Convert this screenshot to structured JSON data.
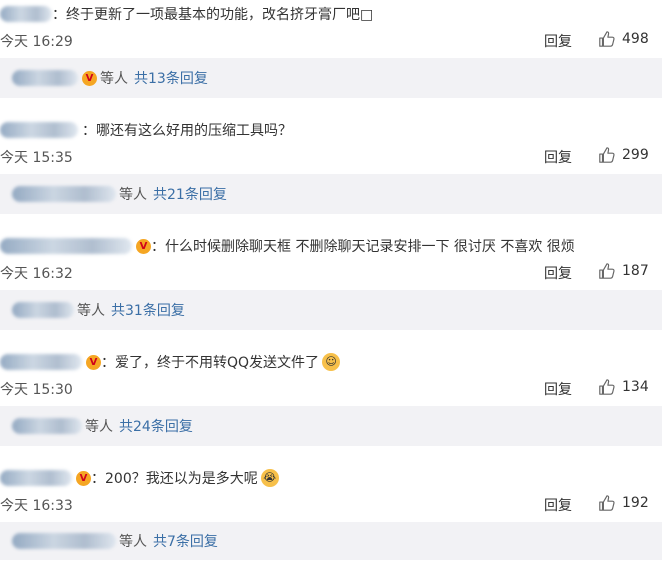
{
  "colors": {
    "link": "#3b6fa6",
    "text": "#333333",
    "sub_bg": "#f2f2f5"
  },
  "icons": {
    "like": "thumbs-up-outline-icon"
  },
  "comments": [
    {
      "text": "：终于更新了一项最基本的功能，改名挤牙膏厂吧□",
      "time": "今天 16:29",
      "reply": "回复",
      "likes": "498",
      "sub_dengren": "等人",
      "sub_total": "共13条回复"
    },
    {
      "text": "：哪还有这么好用的压缩工具吗？",
      "time": "今天 15:35",
      "reply": "回复",
      "likes": "299",
      "sub_dengren": "等人",
      "sub_total": "共21条回复"
    },
    {
      "text": "：什么时候删除聊天框 不删除聊天记录安排一下 很讨厌 不喜欢 很烦",
      "time": "今天 16:32",
      "reply": "回复",
      "likes": "187",
      "sub_dengren": "等人",
      "sub_total": "共31条回复"
    },
    {
      "text": "：爱了，终于不用转QQ发送文件了",
      "time": "今天 15:30",
      "reply": "回复",
      "likes": "134",
      "sub_dengren": "等人",
      "sub_total": "共24条回复"
    },
    {
      "text": "：200？我还以为是多大呢",
      "time": "今天 16:33",
      "reply": "回复",
      "likes": "192",
      "sub_dengren": "等人",
      "sub_total": "共7条回复"
    }
  ]
}
